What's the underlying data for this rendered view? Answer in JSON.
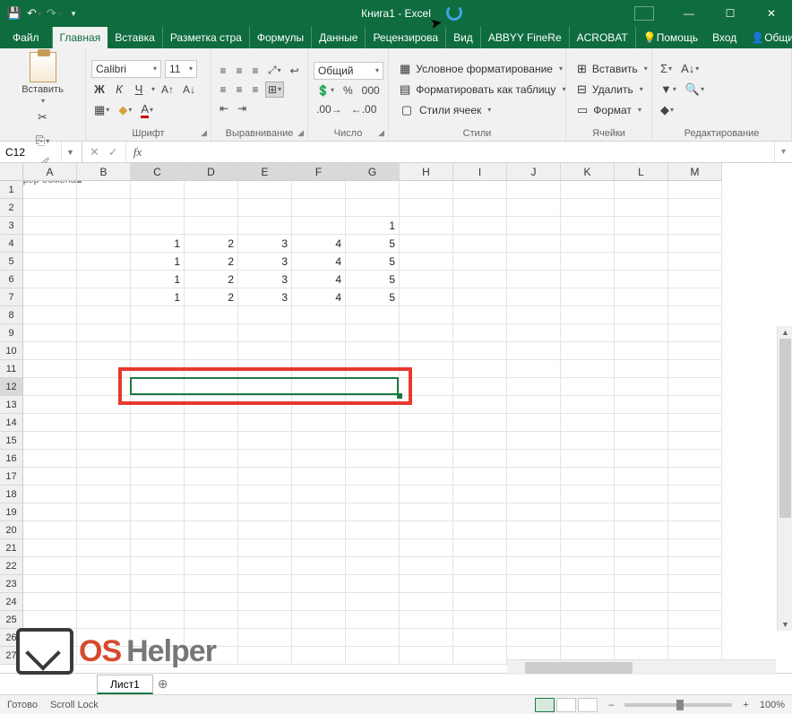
{
  "title": "Книга1 - Excel",
  "qat": {
    "save": "💾"
  },
  "tabs": {
    "file": "Файл",
    "home": "Главная",
    "insert": "Вставка",
    "layout": "Разметка стра",
    "formulas": "Формулы",
    "data": "Данные",
    "review": "Рецензирова",
    "view": "Вид",
    "abbyy": "ABBYY FineRe",
    "acrobat": "ACROBAT",
    "help": "Помощь",
    "signin": "Вход",
    "share": "Общий доступ"
  },
  "clipboard": {
    "paste": "Вставить",
    "label": "Буфер обмена"
  },
  "font": {
    "name": "Calibri",
    "size": "11",
    "bold": "Ж",
    "italic": "К",
    "underline": "Ч",
    "label": "Шрифт"
  },
  "alignment": {
    "label": "Выравнивание"
  },
  "number": {
    "format": "Общий",
    "label": "Число"
  },
  "styles": {
    "cond": "Условное форматирование",
    "table": "Форматировать как таблицу",
    "cell": "Стили ячеек",
    "label": "Стили"
  },
  "cells": {
    "insert": "Вставить",
    "delete": "Удалить",
    "format": "Формат",
    "label": "Ячейки"
  },
  "editing": {
    "label": "Редактирование"
  },
  "namebox": "C12",
  "columns": [
    "A",
    "B",
    "C",
    "D",
    "E",
    "F",
    "G",
    "H",
    "I",
    "J",
    "K",
    "L",
    "M"
  ],
  "rowcount": 27,
  "selected_cols": [
    "C",
    "D",
    "E",
    "F",
    "G"
  ],
  "selected_row": 12,
  "data_cells": {
    "3": {
      "G": "1"
    },
    "4": {
      "C": "1",
      "D": "2",
      "E": "3",
      "F": "4",
      "G": "5"
    },
    "5": {
      "C": "1",
      "D": "2",
      "E": "3",
      "F": "4",
      "G": "5"
    },
    "6": {
      "C": "1",
      "D": "2",
      "E": "3",
      "F": "4",
      "G": "5"
    },
    "7": {
      "C": "1",
      "D": "2",
      "E": "3",
      "F": "4",
      "G": "5"
    }
  },
  "sheet": "Лист1",
  "status": {
    "ready": "Готово",
    "scroll": "Scroll Lock",
    "zoom": "100%"
  },
  "watermark": {
    "a": "OS",
    "b": "Helper"
  }
}
